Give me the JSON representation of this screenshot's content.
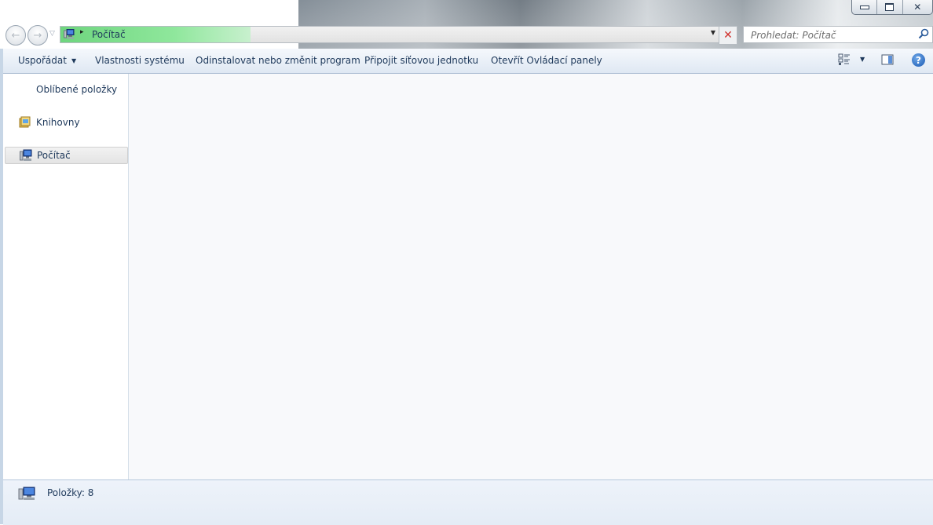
{
  "window": {
    "caption": {
      "minimize": "",
      "maximize": "",
      "close": "✕"
    }
  },
  "address": {
    "location": "Počítač",
    "separator": "▸",
    "dropdown": "▼",
    "stop": "✕"
  },
  "search": {
    "placeholder": "Prohledat: Počítač"
  },
  "navigation": {
    "back": "←",
    "forward": "→",
    "recent": "▽"
  },
  "toolbar": {
    "organize": "Uspořádat",
    "organize_arrow": "▼",
    "system_properties": "Vlastnosti systému",
    "uninstall": "Odinstalovat nebo změnit program",
    "map_drive": "Připojit síťovou jednotku",
    "control_panel": "Otevřít Ovládací panely",
    "views_arrow": "▼",
    "help": "?"
  },
  "sidebar": {
    "items": [
      {
        "label": "Oblíbené položky",
        "icon": "star-icon"
      },
      {
        "label": "Knihovny",
        "icon": "library-icon"
      },
      {
        "label": "Počítač",
        "icon": "computer-icon",
        "selected": true
      }
    ]
  },
  "status": {
    "items_count": "Položky: 8"
  },
  "colors": {
    "accent": "#1e395b",
    "progress": "#6ed57e"
  }
}
